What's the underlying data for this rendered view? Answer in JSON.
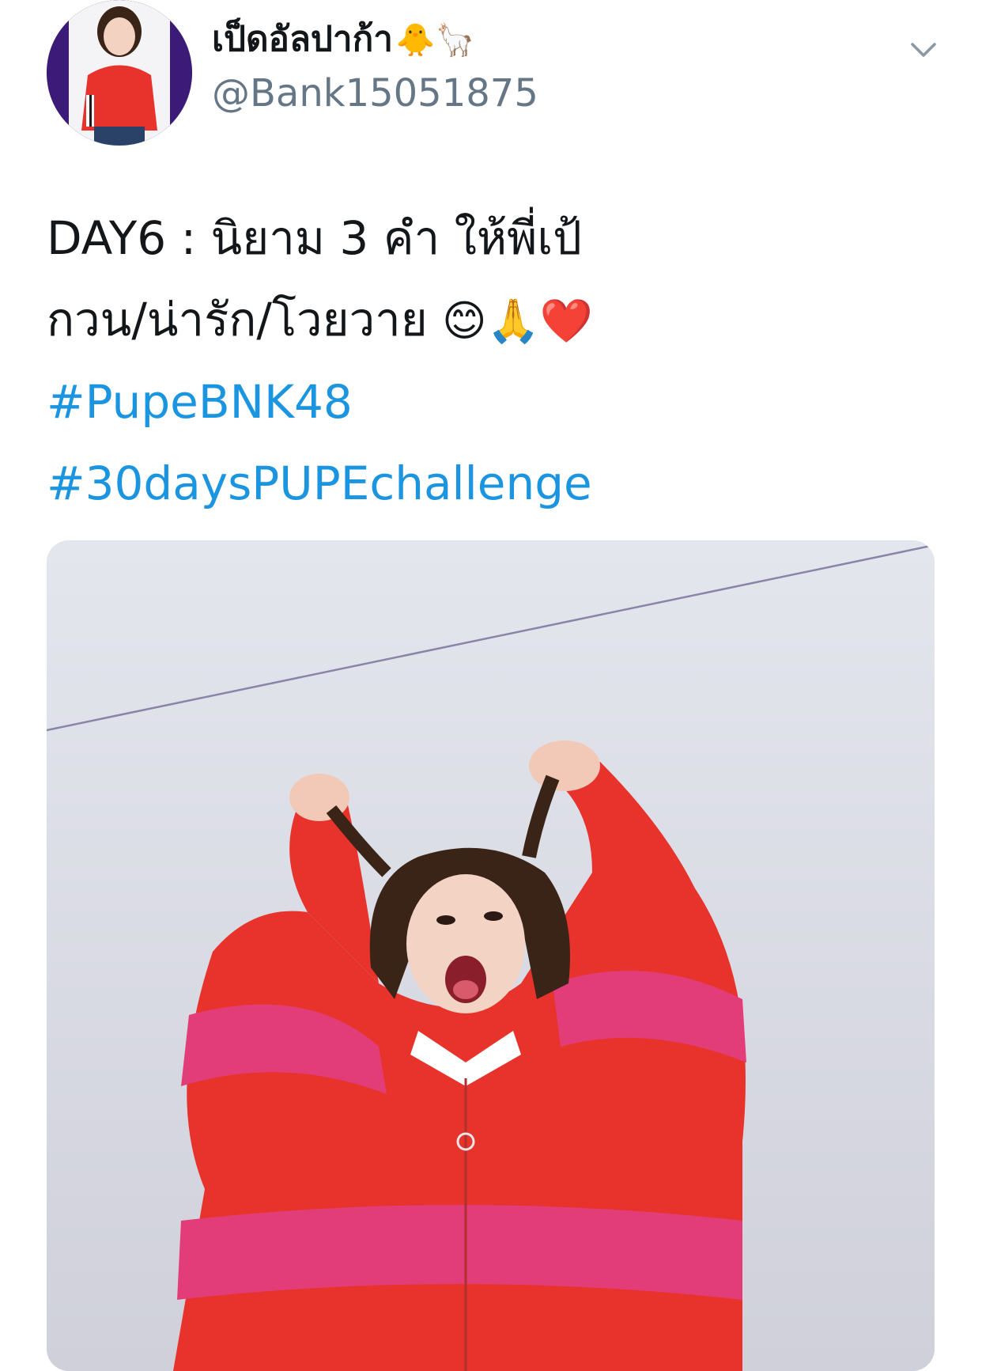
{
  "author": {
    "display_name": "เป็ดอัลปาก้า",
    "name_emojis": "🐥🦙",
    "handle": "@Bank15051875"
  },
  "tweet": {
    "line1": "DAY6 : นิยาม 3 คำ ให้พี่เป้",
    "line2": "กวน/น่ารัก/โวยวาย",
    "line2_emojis": "😊🙏❤️",
    "hashtags": [
      "#PupeBNK48",
      "#30daysPUPEchallenge"
    ]
  },
  "icons": {
    "menu": "chevron-down-icon"
  },
  "colors": {
    "text": "#14171a",
    "secondary": "#657786",
    "link": "#1b95e0",
    "avatar_bg": "#3b1a78",
    "sweater_red": "#e8332c",
    "sweater_pink": "#e23d79"
  }
}
